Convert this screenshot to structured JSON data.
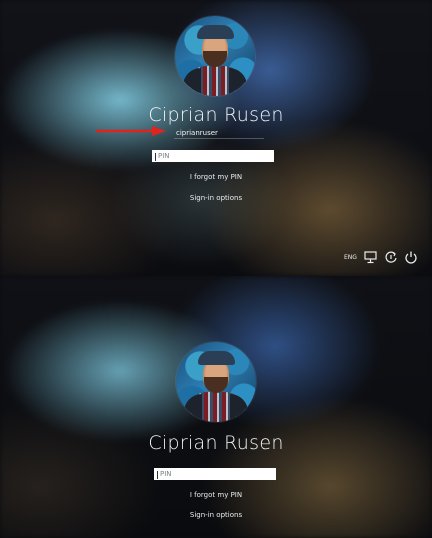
{
  "screen_top": {
    "user": {
      "name": "Ciprian Rusen"
    },
    "account_field": {
      "value": "ciprianruser"
    },
    "pin_field": {
      "placeholder": "PIN"
    },
    "forgot_pin": {
      "label": "I forgot my PIN"
    },
    "signin_options": {
      "label": "Sign-in options"
    },
    "tray": {
      "language": "ENG",
      "icons": [
        "network-icon",
        "accessibility-icon",
        "power-icon"
      ]
    },
    "annotation": {
      "arrow_color": "#e0231d"
    }
  },
  "screen_bottom": {
    "user": {
      "name": "Ciprian Rusen"
    },
    "pin_field": {
      "placeholder": "PIN"
    },
    "forgot_pin": {
      "label": "I forgot my PIN"
    },
    "signin_options": {
      "label": "Sign-in options"
    }
  }
}
